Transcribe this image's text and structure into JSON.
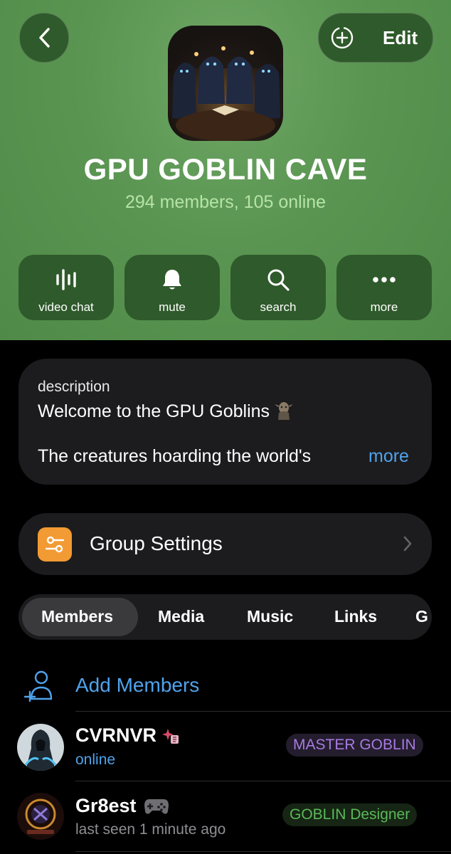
{
  "header": {
    "edit_label": "Edit",
    "title": "GPU GOBLIN CAVE",
    "subtitle": "294 members, 105 online",
    "icons": {
      "back": "chevron-left-icon",
      "add_profile_photo": "plus-circle-icon"
    }
  },
  "actions": [
    {
      "label": "video chat",
      "icon": "voice-wave-icon"
    },
    {
      "label": "mute",
      "icon": "bell-icon"
    },
    {
      "label": "search",
      "icon": "search-icon"
    },
    {
      "label": "more",
      "icon": "ellipsis-icon"
    }
  ],
  "description": {
    "label": "description",
    "line1": "Welcome to the GPU Goblins",
    "line2": "The creatures hoarding the world's",
    "more_label": "more"
  },
  "settings": {
    "label": "Group Settings",
    "icon": "sliders-icon"
  },
  "tabs": [
    "Members",
    "Media",
    "Music",
    "Links",
    "G"
  ],
  "active_tab": "Members",
  "add_members_label": "Add Members",
  "members": [
    {
      "name": "CVRNVR",
      "status": "online",
      "role": "MASTER GOBLIN",
      "role_color": "#a77be0",
      "status_color": "#4fa3ec",
      "emoji": "sparkle-badge-icon"
    },
    {
      "name": "Gr8est",
      "status": "last seen 1 minute ago",
      "role": "GOBLIN Designer",
      "role_color": "#5bb85a",
      "status_color": "#8e8e93",
      "emoji": "gamepad-icon"
    }
  ],
  "colors": {
    "header_bg": "#5a9552",
    "header_button_bg": "#2f5a2b",
    "card_bg": "#1c1c1e",
    "link_blue": "#4fa3ec",
    "subtitle_green": "#b6e3a8",
    "settings_orange": "#f29a33"
  }
}
